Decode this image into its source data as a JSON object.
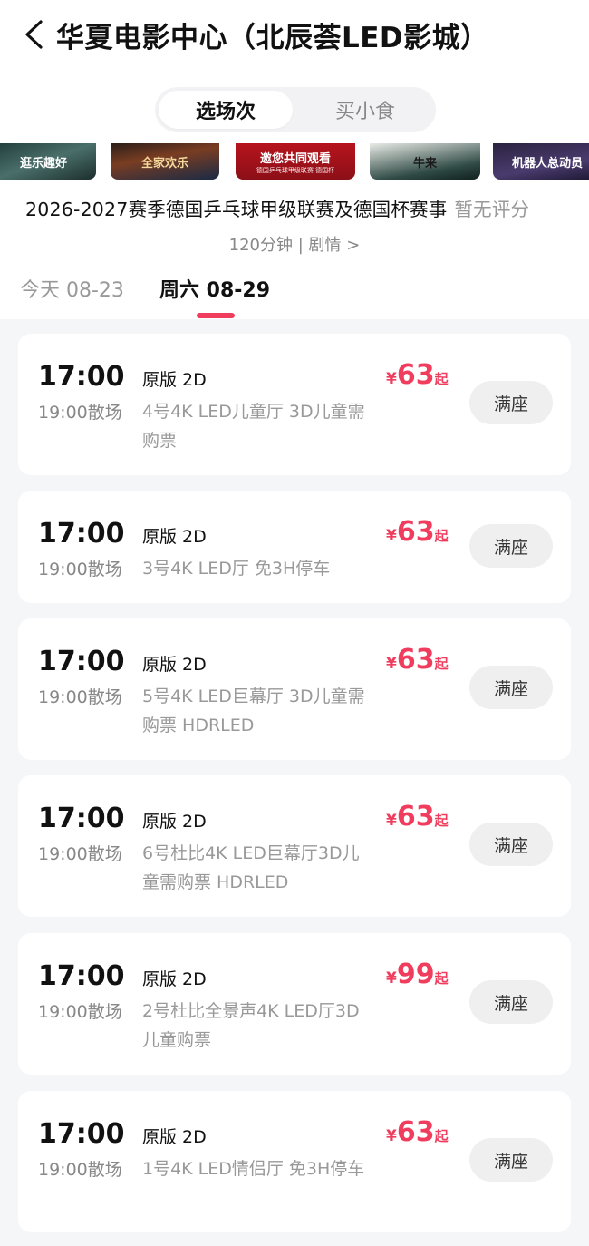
{
  "header": {
    "title": "华夏电影中心（北辰荟LED影城）"
  },
  "segments": {
    "active": "选场次",
    "inactive": "买小食"
  },
  "posters": [
    {
      "text": "逛乐趣好"
    },
    {
      "text": "全家欢乐"
    },
    {
      "text": "邀您共同观看",
      "sub": "德国乒乓球甲级联赛 德国杯"
    },
    {
      "text": "牛来"
    },
    {
      "text": "机器人总动员"
    }
  ],
  "movie": {
    "title": "2026-2027赛季德国乒乓球甲级联赛及德国杯赛事",
    "rating": "暂无评分",
    "meta": "120分钟 | 剧情 >"
  },
  "dates": [
    {
      "label": "今天 08-23",
      "active": false
    },
    {
      "label": "周六 08-29",
      "active": true
    }
  ],
  "colors": {
    "accent": "#f03d5e",
    "list_bg": "#f5f6f8"
  },
  "showtimes": [
    {
      "start": "17:00",
      "end": "19:00散场",
      "version": "原版 2D",
      "hall": "4号4K LED儿童厅 3D儿童需购票",
      "currency": "¥",
      "price": "63",
      "suffix": "起",
      "button": "满座"
    },
    {
      "start": "17:00",
      "end": "19:00散场",
      "version": "原版 2D",
      "hall": "3号4K LED厅 免3H停车",
      "currency": "¥",
      "price": "63",
      "suffix": "起",
      "button": "满座"
    },
    {
      "start": "17:00",
      "end": "19:00散场",
      "version": "原版 2D",
      "hall": "5号4K LED巨幕厅 3D儿童需购票 HDRLED",
      "currency": "¥",
      "price": "63",
      "suffix": "起",
      "button": "满座"
    },
    {
      "start": "17:00",
      "end": "19:00散场",
      "version": "原版 2D",
      "hall": "6号杜比4K LED巨幕厅3D儿童需购票 HDRLED",
      "currency": "¥",
      "price": "63",
      "suffix": "起",
      "button": "满座"
    },
    {
      "start": "17:00",
      "end": "19:00散场",
      "version": "原版 2D",
      "hall": "2号杜比全景声4K LED厅3D儿童购票",
      "currency": "¥",
      "price": "99",
      "suffix": "起",
      "button": "满座"
    },
    {
      "start": "17:00",
      "end": "19:00散场",
      "version": "原版 2D",
      "hall": "1号4K LED情侣厅 免3H停车",
      "currency": "¥",
      "price": "63",
      "suffix": "起",
      "button": "满座"
    }
  ]
}
